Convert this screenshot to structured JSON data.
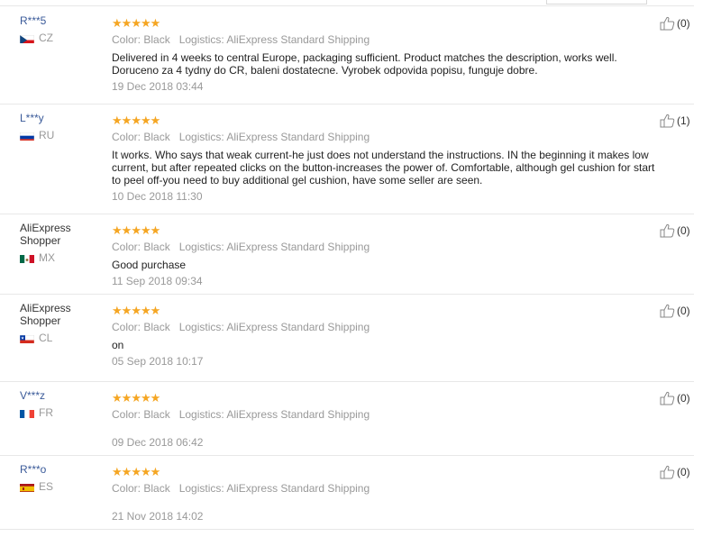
{
  "reviews": [
    {
      "user": "R***5",
      "country": "CZ",
      "flag": "cz",
      "color": "Color: Black",
      "logistics": "Logistics: AliExpress Standard Shipping",
      "feedback": "Delivered in 4 weeks to central Europe, packaging sufficient. Product matches the description, works well. Doruceno za 4 tydny do CR, baleni dostatecne. Vyrobek odpovida popisu, funguje dobre.",
      "date": "19 Dec 2018 03:44",
      "helpful": "(0)",
      "stars": 5
    },
    {
      "user": "L***y",
      "country": "RU",
      "flag": "ru",
      "color": "Color: Black",
      "logistics": "Logistics: AliExpress Standard Shipping",
      "feedback": "It works. Who says that weak current-he just does not understand the instructions. IN the beginning it makes low current, but after repeated clicks on the button-increases the power of. Comfortable, although gel cushion for start to peel off-you need to buy additional gel cushion, have some seller are seen.",
      "date": "10 Dec 2018 11:30",
      "helpful": "(1)",
      "stars": 5
    },
    {
      "user": "AliExpress Shopper",
      "country": "MX",
      "flag": "mx",
      "color": "Color: Black",
      "logistics": "Logistics: AliExpress Standard Shipping",
      "feedback": "Good purchase",
      "date": "11 Sep 2018 09:34",
      "helpful": "(0)",
      "stars": 5
    },
    {
      "user": "AliExpress Shopper",
      "country": "CL",
      "flag": "cl",
      "color": "Color: Black",
      "logistics": "Logistics: AliExpress Standard Shipping",
      "feedback": "on",
      "date": "05 Sep 2018 10:17",
      "helpful": "(0)",
      "stars": 5
    },
    {
      "user": "V***z",
      "country": "FR",
      "flag": "fr",
      "color": "Color: Black",
      "logistics": "Logistics: AliExpress Standard Shipping",
      "feedback": "",
      "date": "09 Dec 2018 06:42",
      "helpful": "(0)",
      "stars": 5
    },
    {
      "user": "R***o",
      "country": "ES",
      "flag": "es",
      "color": "Color: Black",
      "logistics": "Logistics: AliExpress Standard Shipping",
      "feedback": "",
      "date": "21 Nov 2018 14:02",
      "helpful": "(0)",
      "stars": 5
    }
  ],
  "colors": {
    "star": "#f5a623",
    "muted": "#999999",
    "masked_name": "#3a5a99"
  },
  "icons": {
    "star": "star-icon",
    "helpful": "thumbs-up-icon"
  }
}
